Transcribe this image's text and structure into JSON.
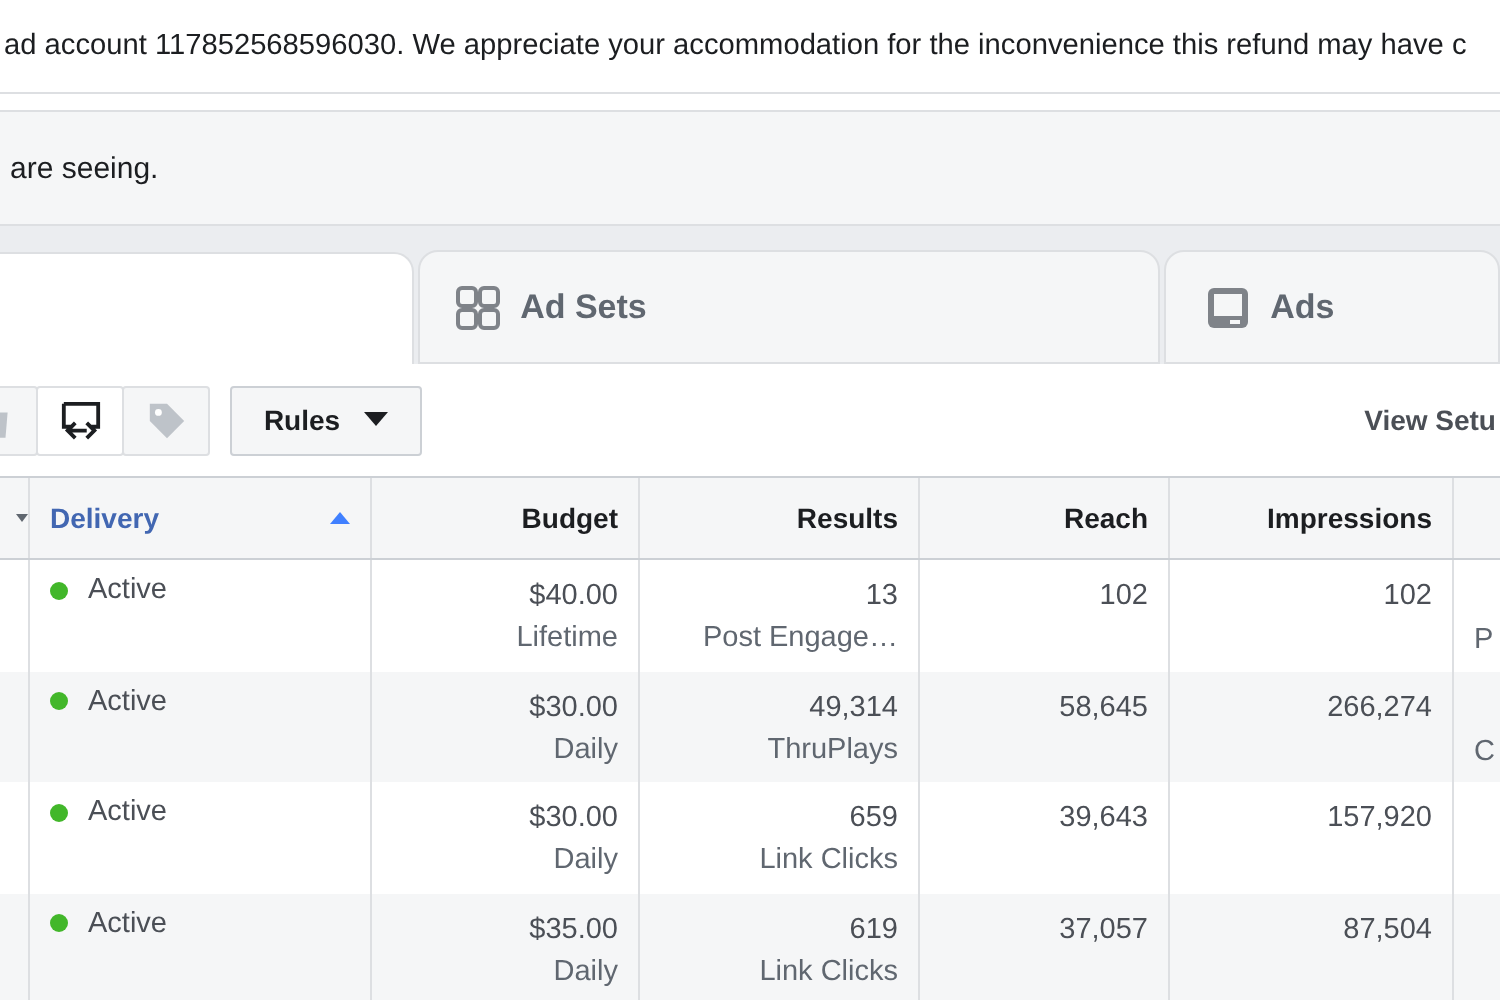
{
  "notice": {
    "text": "ad account 117852568596030. We appreciate your accommodation for the inconvenience this refund may have c"
  },
  "banner": {
    "text": "are seeing."
  },
  "tabs": [
    {
      "kind": "blank",
      "selected": true
    },
    {
      "kind": "adsets",
      "label": "Ad Sets",
      "selected": false
    },
    {
      "kind": "ads",
      "label": "Ads",
      "selected": false
    }
  ],
  "toolbar": {
    "buttons": [
      {
        "kind": "trash",
        "disabled": true
      },
      {
        "kind": "swap",
        "disabled": false
      },
      {
        "kind": "tag",
        "disabled": true
      }
    ],
    "rules": {
      "label": "Rules"
    },
    "view_setup": "View Setu"
  },
  "table": {
    "columns": [
      {
        "sorted": false
      },
      {
        "label": "Delivery",
        "sorted": true
      },
      {
        "label": "Budget",
        "sorted": false
      },
      {
        "label": "Results",
        "sorted": false
      },
      {
        "label": "Reach",
        "sorted": false
      },
      {
        "label": "Impressions",
        "sorted": false
      },
      {
        "sorted": false
      }
    ],
    "rows": [
      {
        "status": "Active",
        "color": "#42b72a",
        "budget": "$40.00",
        "budget_type": "Lifetime",
        "results": "13",
        "result_type": "Post Engage…",
        "reach": "102",
        "impressions": "102",
        "column_7": "P"
      },
      {
        "status": "Active",
        "color": "#42b72a",
        "budget": "$30.00",
        "budget_type": "Daily",
        "results": "49,314",
        "result_type": "ThruPlays",
        "reach": "58,645",
        "impressions": "266,274",
        "column_7": "C"
      },
      {
        "status": "Active",
        "color": "#42b72a",
        "budget": "$30.00",
        "budget_type": "Daily",
        "results": "659",
        "result_type": "Link Clicks",
        "reach": "39,643",
        "impressions": "157,920",
        "column_7": null
      },
      {
        "status": "Active",
        "color": "#42b72a",
        "budget": "$35.00",
        "budget_type": "Daily",
        "results": "619",
        "result_type": "Link Clicks",
        "reach": "37,057",
        "impressions": "87,504",
        "column_7": null
      }
    ]
  }
}
